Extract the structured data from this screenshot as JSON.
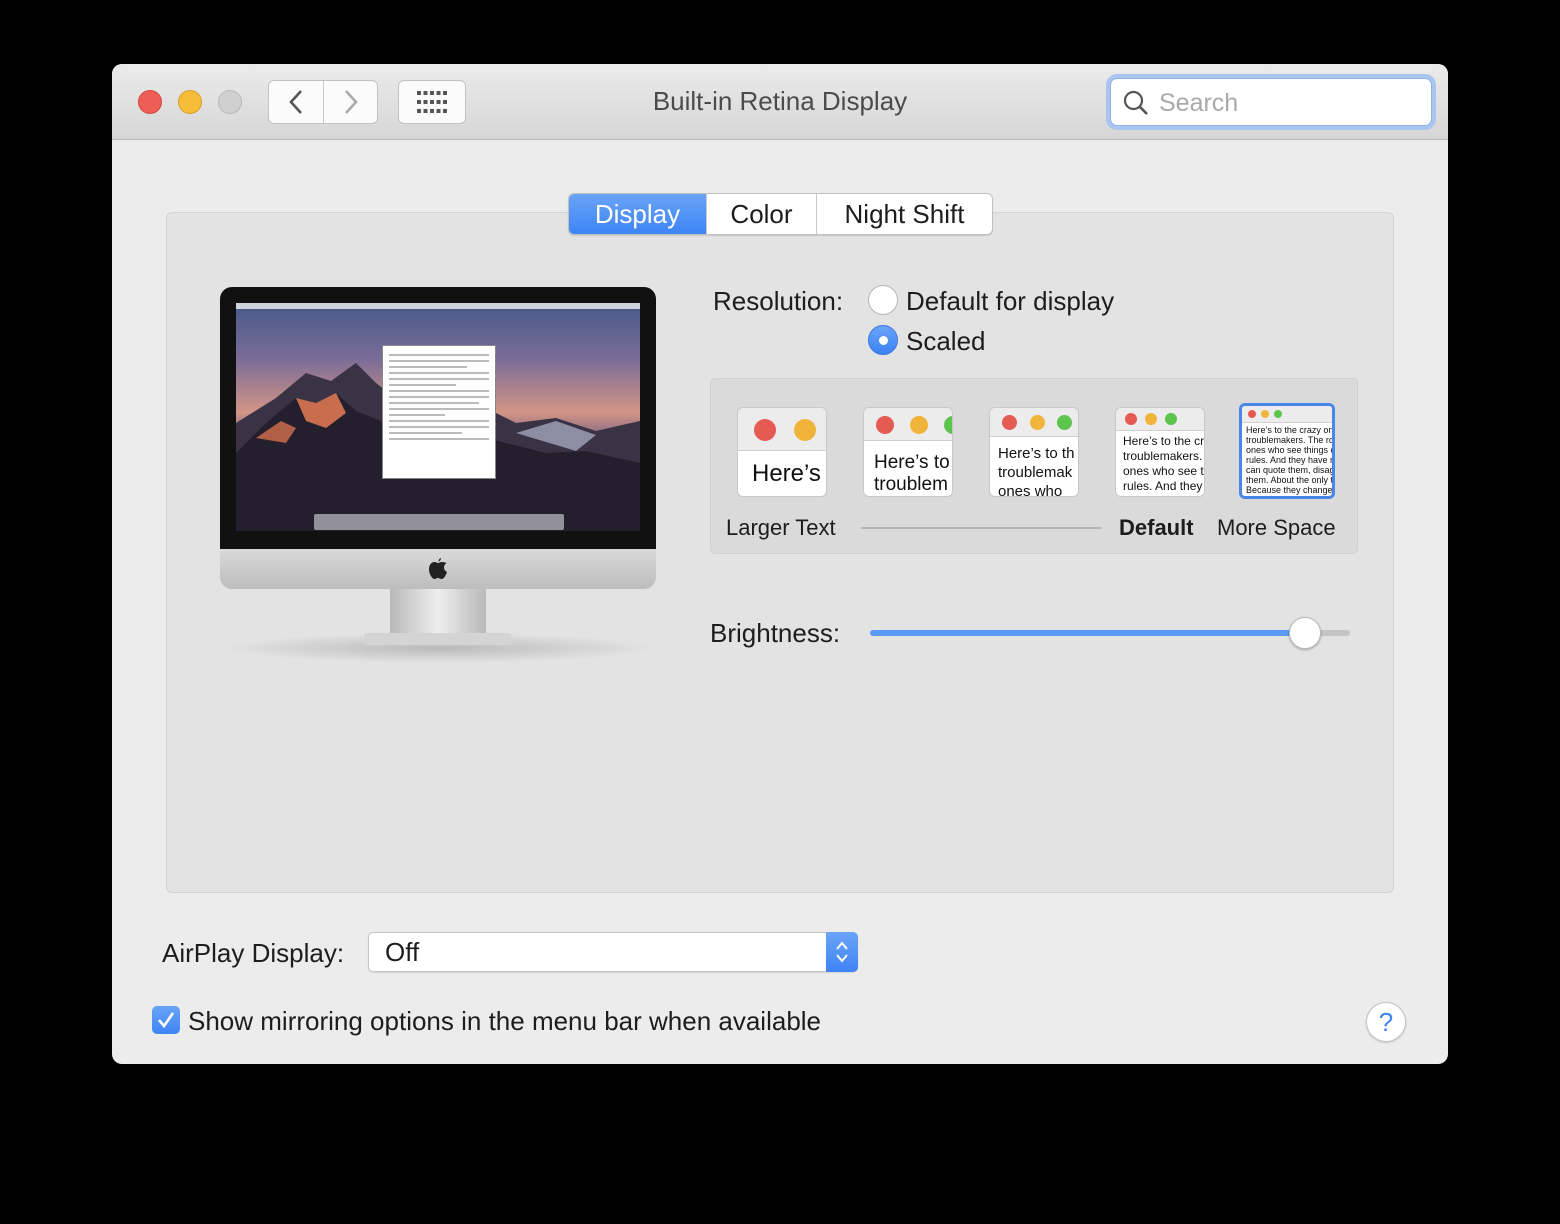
{
  "window": {
    "title": "Built-in Retina Display"
  },
  "search": {
    "placeholder": "Search"
  },
  "tabs": [
    {
      "label": "Display",
      "active": true
    },
    {
      "label": "Color",
      "active": false
    },
    {
      "label": "Night Shift",
      "active": false
    }
  ],
  "resolution": {
    "label": "Resolution:",
    "options": [
      {
        "label": "Default for display",
        "selected": false
      },
      {
        "label": "Scaled",
        "selected": true
      }
    ]
  },
  "scaling": {
    "thumbnails": [
      {
        "text": "Here’s"
      },
      {
        "text": "Here’s to\ntroublem"
      },
      {
        "text": "Here’s to th\ntroublemak\nones who"
      },
      {
        "text": "Here’s to the cr\ntroublemakers.\nones who see t\nrules. And they"
      },
      {
        "text": "Here’s to the crazy one\ntroublemakers. The rou\nones who see things di\nrules. And they have no\ncan quote them, disagr\nthem. About the only th\nBecause they change t"
      }
    ],
    "selected_index": 4,
    "labels": {
      "larger": "Larger Text",
      "default": "Default",
      "more": "More Space"
    }
  },
  "brightness": {
    "label": "Brightness:",
    "value": 0.93
  },
  "airplay": {
    "label": "AirPlay Display:",
    "value": "Off"
  },
  "mirroring": {
    "label": "Show mirroring options in the menu bar when available",
    "checked": true
  },
  "help": {
    "label": "?"
  },
  "colors": {
    "accent": "#3d84f5",
    "close": "#ed5e57",
    "minimize": "#f5bd38"
  }
}
